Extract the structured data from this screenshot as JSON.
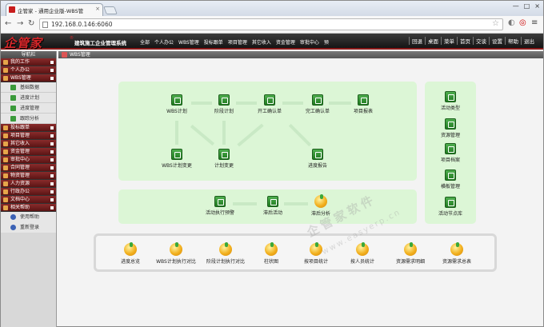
{
  "browser": {
    "tab_title": "企管家 - 通用企业版-WBS管",
    "url": "192.168.0.146:6060",
    "window_buttons": [
      "—",
      "□",
      "×"
    ]
  },
  "header": {
    "logo_text": "企管家",
    "logo_reg": "®",
    "system_name": "建筑施工企业管理系统",
    "top_menu": [
      "全部",
      "个人办公",
      "WBS管理",
      "投标跟单",
      "项目管理",
      "其它收入",
      "资金管理",
      "审批中心",
      "预"
    ],
    "right_menu": [
      "回退",
      "桌面",
      "菜单",
      "首页",
      "交谈",
      "设置",
      "帮助",
      "退出"
    ]
  },
  "sidebar": {
    "title": "导航栏",
    "items": [
      {
        "label": "我的工作",
        "type": "group"
      },
      {
        "label": "个人办公",
        "type": "group"
      },
      {
        "label": "WBS管理",
        "type": "group"
      },
      {
        "label": "基础数据",
        "type": "sub"
      },
      {
        "label": "进度计划",
        "type": "sub"
      },
      {
        "label": "进度管理",
        "type": "sub"
      },
      {
        "label": "跟踪分析",
        "type": "sub"
      },
      {
        "label": "投标跟单",
        "type": "group"
      },
      {
        "label": "项目管理",
        "type": "group"
      },
      {
        "label": "其它收入",
        "type": "group"
      },
      {
        "label": "资金管理",
        "type": "group"
      },
      {
        "label": "审批中心",
        "type": "group"
      },
      {
        "label": "合同管理",
        "type": "group"
      },
      {
        "label": "物资管理",
        "type": "group"
      },
      {
        "label": "人力资源",
        "type": "group"
      },
      {
        "label": "行政办公",
        "type": "group"
      },
      {
        "label": "文档中心",
        "type": "group"
      },
      {
        "label": "相关帮助",
        "type": "group"
      },
      {
        "label": "使用帮助",
        "type": "help"
      },
      {
        "label": "重新登录",
        "type": "help"
      }
    ]
  },
  "breadcrumb": "WBS管理",
  "flow_nodes": {
    "wbs_plan": "WBS计划",
    "stage_plan": "阶段计划",
    "start_confirm": "开工确认单",
    "finish_confirm": "完工确认单",
    "project_report": "项目报表",
    "wbs_change": "WBS计划变更",
    "plan_change": "计划变更",
    "progress_report": "进度报告",
    "activity_warning": "活动执行预警",
    "lagging_activity": "滞后活动",
    "lagging_analysis": "滞后分析"
  },
  "side_nodes": [
    "活动类型",
    "资源管理",
    "项目档案",
    "横板管理",
    "活动节点库"
  ],
  "report_nodes": [
    "进度总览",
    "WBS计划执行对比",
    "阶段计划执行对比",
    "柱状图",
    "按项目统计",
    "按人员统计",
    "资源需求明细",
    "资源需求总表"
  ],
  "watermark": {
    "line1": "企管家软件",
    "line2": "www.easyerp.cn"
  }
}
